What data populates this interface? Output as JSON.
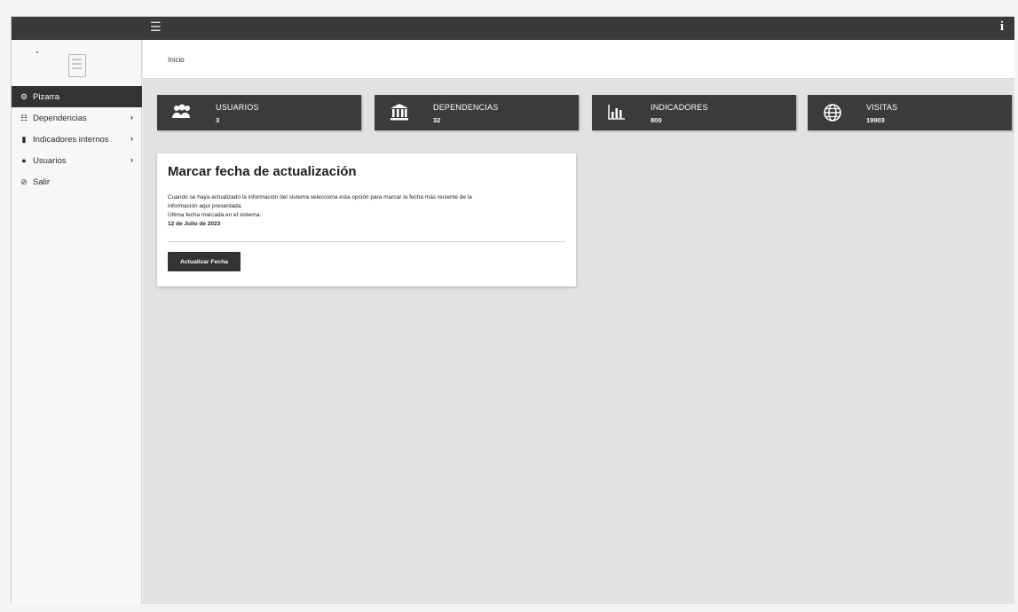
{
  "breadcrumb": "Inicio",
  "sidebar": {
    "items": [
      {
        "label": "Pizarra",
        "icon": "tachometer-icon",
        "active": true
      },
      {
        "label": "Dependencias",
        "icon": "bank-icon",
        "has_children": true
      },
      {
        "label": "Indicadores internos",
        "icon": "bar-chart-icon",
        "has_children": true
      },
      {
        "label": "Usuarios",
        "icon": "users-icon",
        "has_children": true
      },
      {
        "label": "Salir",
        "icon": "logout-icon"
      }
    ]
  },
  "stats": [
    {
      "label": "USUARIOS",
      "value": "3",
      "icon": "users-icon"
    },
    {
      "label": "DEPENDENCIAS",
      "value": "32",
      "icon": "bank-icon"
    },
    {
      "label": "INDICADORES",
      "value": "800",
      "icon": "bar-chart-icon"
    },
    {
      "label": "VISITAS",
      "value": "19903",
      "icon": "globe-icon"
    }
  ],
  "panel": {
    "title": "Marcar fecha de actualización",
    "line1": "Cuando se haya actualizado la información del sistema selecciona esta opción para marcar la fecha más reciente de la",
    "line2": "información aquí presentada.",
    "line3": "Última fecha marcada en el sistema:",
    "date": "12 de Julio de 2023",
    "button": "Actualizar Fecha"
  },
  "colors": {
    "topbar": "#3a3a3a",
    "card": "#3b3b3b",
    "active_nav": "#333333"
  }
}
